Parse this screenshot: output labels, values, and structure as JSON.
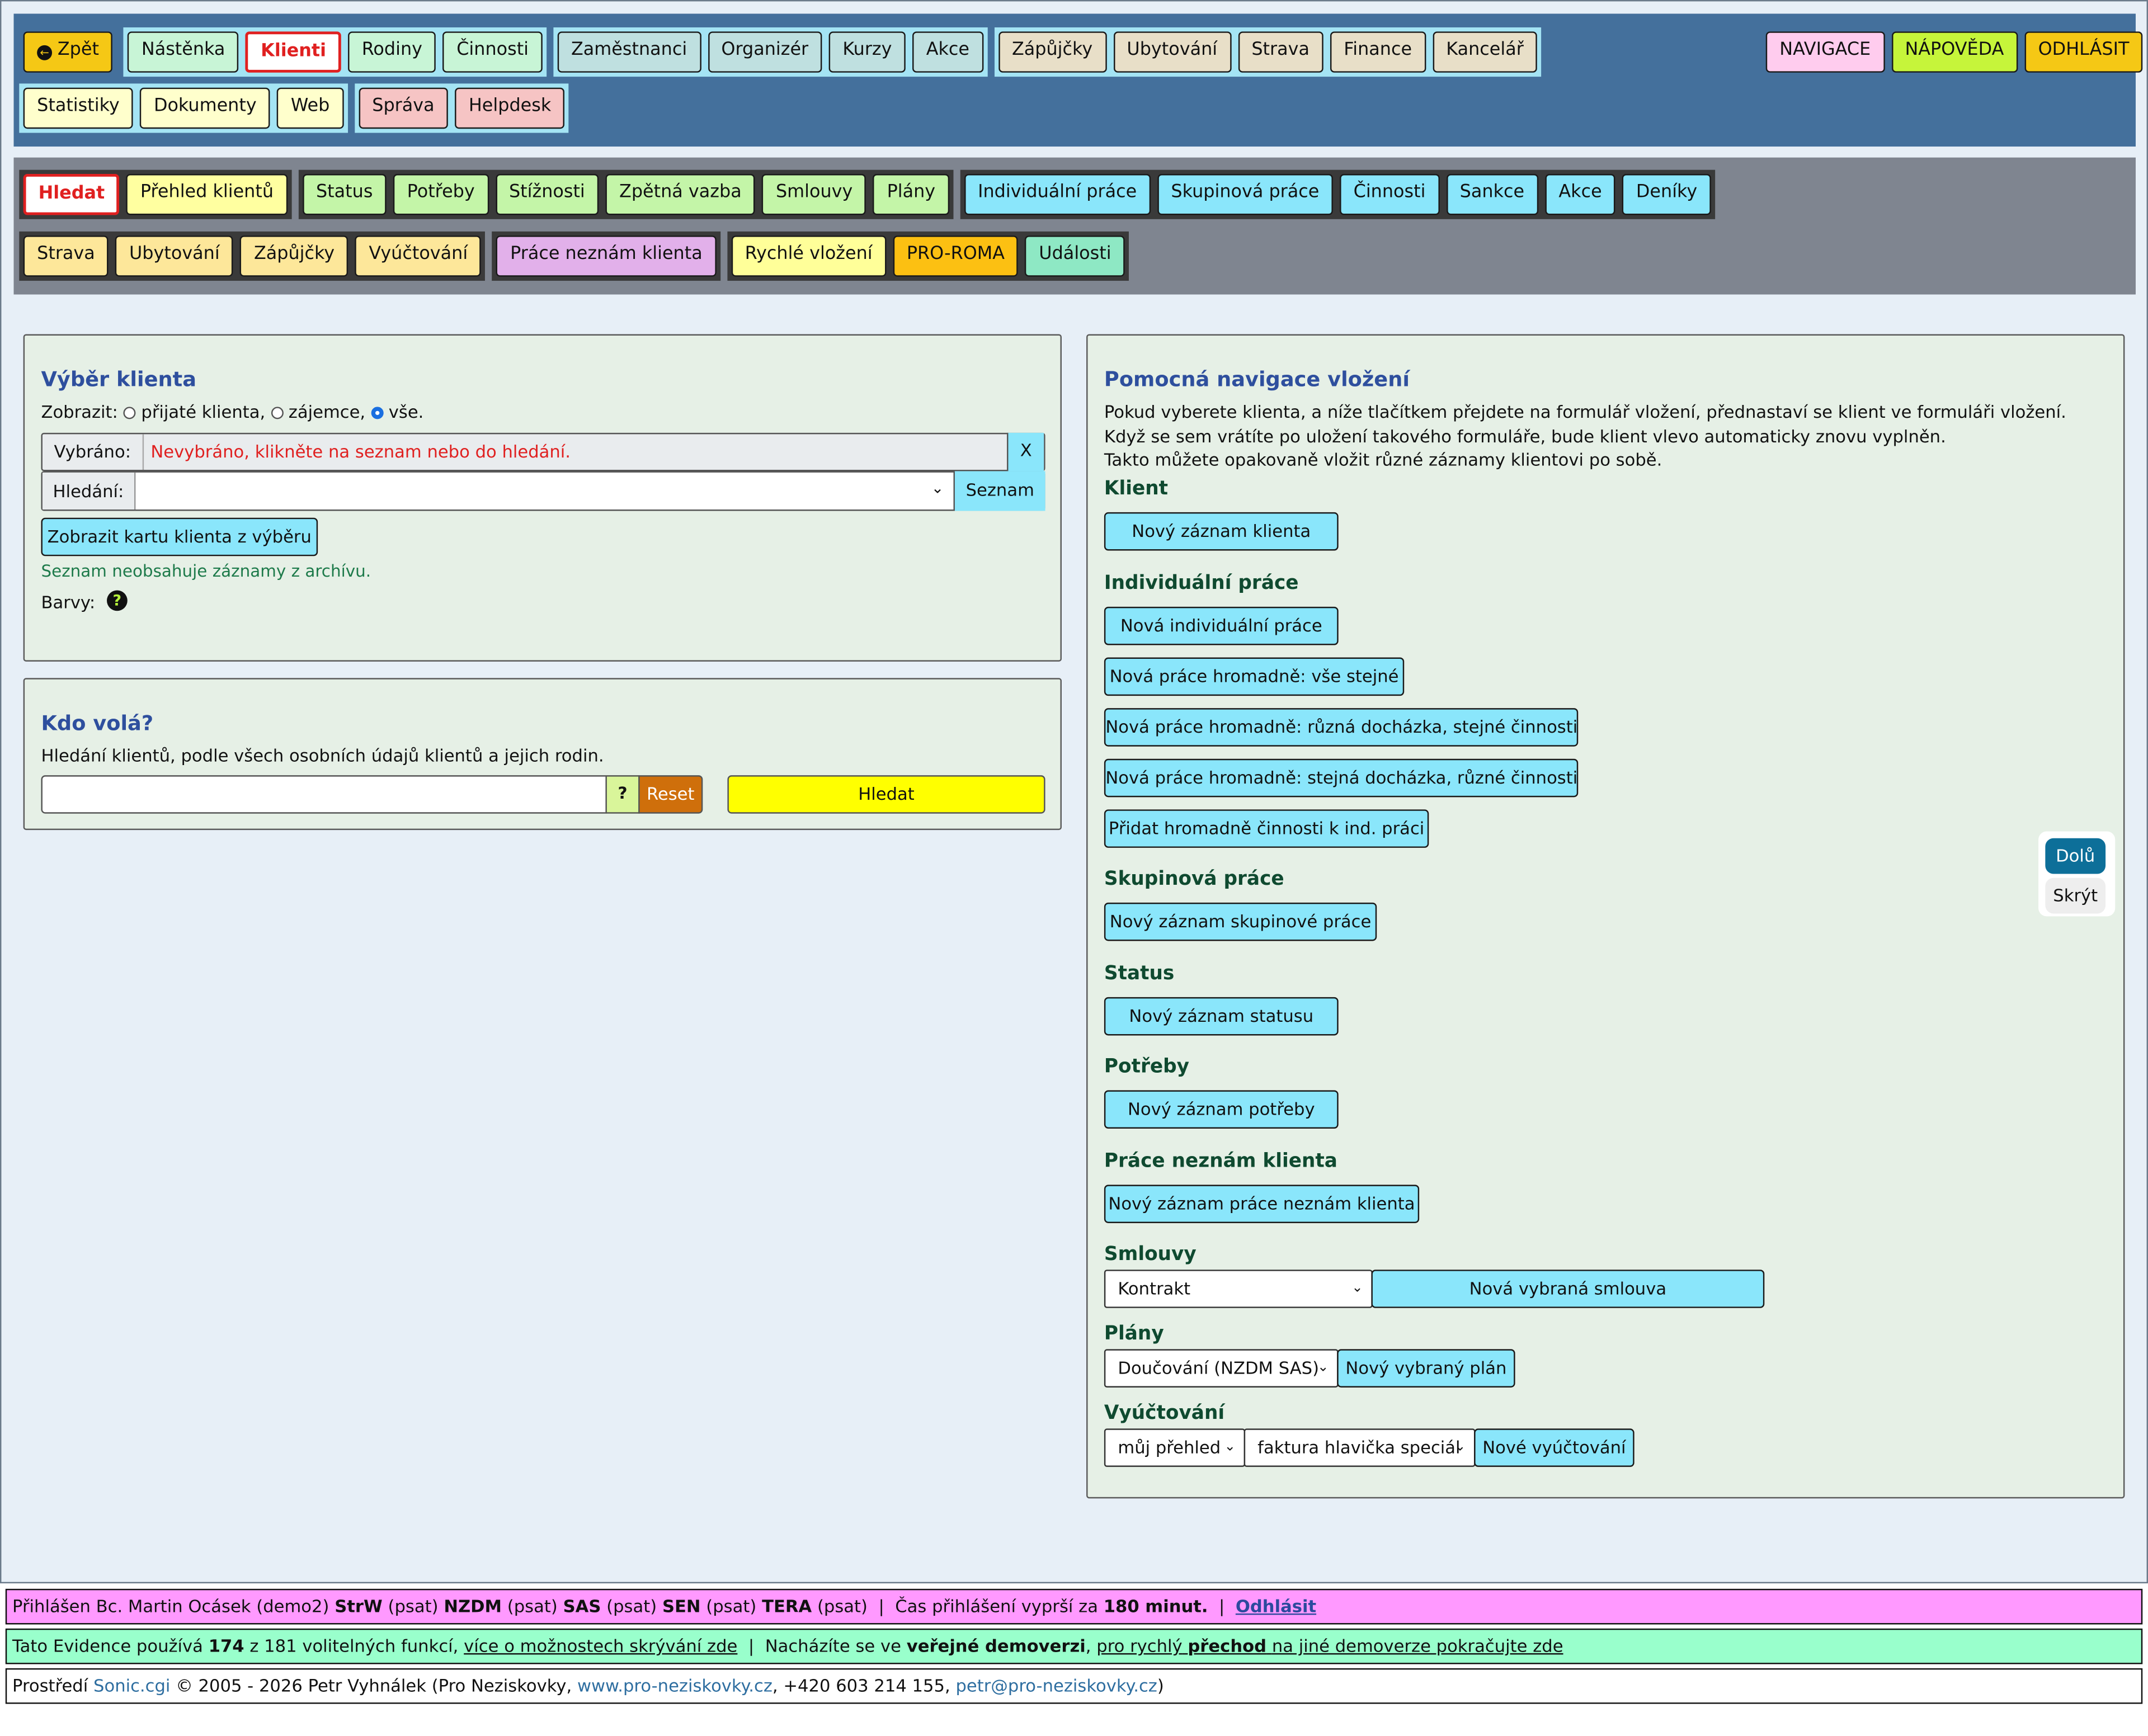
{
  "topnav": {
    "row1": [
      {
        "items": [
          {
            "label": "Zpět",
            "color": "#f5c815",
            "icon": "arrow-left-circle-icon"
          }
        ],
        "bg": "#44709c"
      },
      {
        "items": [
          {
            "label": "Nástěnka",
            "color": "#c8f5d6"
          },
          {
            "label": "Klienti",
            "color": "#ffffff",
            "active": true
          },
          {
            "label": "Rodiny",
            "color": "#c8f5d6"
          },
          {
            "label": "Činnosti",
            "color": "#c8f5d6"
          }
        ],
        "bg": "#a4e4f4"
      },
      {
        "items": [
          {
            "label": "Zaměstnanci",
            "color": "#bfe0e0"
          },
          {
            "label": "Organizér",
            "color": "#bfe0e0"
          },
          {
            "label": "Kurzy",
            "color": "#bfe0e0"
          },
          {
            "label": "Akce",
            "color": "#bfe0e0"
          }
        ],
        "bg": "#a4e4f4"
      },
      {
        "items": [
          {
            "label": "Zápůjčky",
            "color": "#e8dfc8"
          },
          {
            "label": "Ubytování",
            "color": "#e8dfc8"
          },
          {
            "label": "Strava",
            "color": "#e8dfc8"
          },
          {
            "label": "Finance",
            "color": "#e8dfc8"
          },
          {
            "label": "Kancelář",
            "color": "#e8dfc8"
          }
        ],
        "bg": "#a4e4f4"
      }
    ],
    "row2": [
      {
        "items": [
          {
            "label": "Statistiky",
            "color": "#ffffcc"
          },
          {
            "label": "Dokumenty",
            "color": "#ffffcc"
          },
          {
            "label": "Web",
            "color": "#ffffcc"
          }
        ],
        "bg": "#a4e4f4"
      },
      {
        "items": [
          {
            "label": "Správa",
            "color": "#f6c4c4"
          },
          {
            "label": "Helpdesk",
            "color": "#f6c4c4"
          }
        ],
        "bg": "#a4e4f4"
      }
    ],
    "right": [
      {
        "label": "NAVIGACE",
        "color": "#ffccee"
      },
      {
        "label": "NÁPOVĚDA",
        "color": "#c6f53a"
      },
      {
        "label": "ODHLÁSIT",
        "color": "#f5c815"
      }
    ]
  },
  "subnav": {
    "row1": [
      {
        "items": [
          {
            "label": "Hledat",
            "color": "#ffffff",
            "active": true
          },
          {
            "label": "Přehled klientů",
            "color": "#ffffa0"
          }
        ]
      },
      {
        "items": [
          {
            "label": "Status",
            "color": "#c4f5a8"
          },
          {
            "label": "Potřeby",
            "color": "#c4f5a8"
          },
          {
            "label": "Stížnosti",
            "color": "#c4f5a8"
          },
          {
            "label": "Zpětná vazba",
            "color": "#c4f5a8"
          },
          {
            "label": "Smlouvy",
            "color": "#c4f5a8"
          },
          {
            "label": "Plány",
            "color": "#c4f5a8"
          }
        ]
      },
      {
        "items": [
          {
            "label": "Individuální práce",
            "color": "#8ae6fb"
          },
          {
            "label": "Skupinová práce",
            "color": "#8ae6fb"
          },
          {
            "label": "Činnosti",
            "color": "#8ae6fb"
          },
          {
            "label": "Sankce",
            "color": "#8ae6fb"
          },
          {
            "label": "Akce",
            "color": "#8ae6fb"
          },
          {
            "label": "Deníky",
            "color": "#8ae6fb"
          }
        ]
      }
    ],
    "row2": [
      {
        "items": [
          {
            "label": "Strava",
            "color": "#fde79a"
          },
          {
            "label": "Ubytování",
            "color": "#fde79a"
          },
          {
            "label": "Zápůjčky",
            "color": "#fde79a"
          },
          {
            "label": "Vyúčtování",
            "color": "#fde79a"
          }
        ]
      },
      {
        "items": [
          {
            "label": "Práce neznám klienta",
            "color": "#e2b0ea"
          }
        ]
      },
      {
        "items": [
          {
            "label": "Rychlé vložení",
            "color": "#ffff99"
          },
          {
            "label": "PRO-ROMA",
            "color": "#fcc012"
          },
          {
            "label": "Události",
            "color": "#8ee8c4"
          }
        ]
      }
    ]
  },
  "vyber": {
    "title": "Výběr klienta",
    "show_label": "Zobrazit:",
    "opt1": "přijaté klienta,",
    "opt2": "zájemce,",
    "opt3": "vše.",
    "selected_label": "Vybráno:",
    "selected_value": "Nevybráno, klikněte na seznam nebo do hledání.",
    "clear_label": "X",
    "search_label": "Hledání:",
    "list_label": "Seznam",
    "show_card_label": "Zobrazit kartu klienta z výběru",
    "archive_note": "Seznam neobsahuje záznamy z archívu.",
    "colors_label": "Barvy:"
  },
  "kdovola": {
    "title": "Kdo volá?",
    "desc": "Hledání klientů, podle všech osobních údajů klientů a jejich rodin.",
    "help_label": "?",
    "reset_label": "Reset",
    "search_label": "Hledat"
  },
  "pomocna": {
    "title": "Pomocná navigace vložení",
    "line1": "Pokud vyberete klienta, a níže tlačítkem přejdete na formulář vložení, přednastaví se klient ve formuláři vložení.",
    "line2": "Když se sem vrátíte po uložení takového formuláře, bude klient vlevo automaticky znovu vyplněn.",
    "line3": "Takto můžete opakovaně vložit různé záznamy klientovi po sobě.",
    "klient_h": "Klient",
    "klient_btn": "Nový záznam klienta",
    "ind_h": "Individuální práce",
    "ind_b1": "Nová individuální práce",
    "ind_b2": "Nová práce hromadně: vše stejné",
    "ind_b3": "Nová práce hromadně: různá docházka, stejné činnosti",
    "ind_b4": "Nová práce hromadně: stejná docházka, různé činnosti",
    "ind_b5": "Přidat hromadně činnosti k ind. práci",
    "sk_h": "Skupinová práce",
    "sk_btn": "Nový záznam skupinové práce",
    "st_h": "Status",
    "st_btn": "Nový záznam statusu",
    "po_h": "Potřeby",
    "po_btn": "Nový záznam potřeby",
    "pn_h": "Práce neznám klienta",
    "pn_btn": "Nový záznam práce neznám klienta",
    "sm_h": "Smlouvy",
    "sm_sel": "Kontrakt",
    "sm_btn": "Nová vybraná smlouva",
    "pl_h": "Plány",
    "pl_sel": "Doučování (NZDM SAS)",
    "pl_btn": "Nový vybraný plán",
    "vy_h": "Vyúčtování",
    "vy_sel1": "můj přehled",
    "vy_sel2": "faktura hlavička speciál",
    "vy_btn": "Nové vyúčtování"
  },
  "side": {
    "down": "Dolů",
    "hide": "Skrýt"
  },
  "footer": {
    "f1_a": "Přihlášen Bc. Martin Ocásek (demo2)",
    "f1_b1": "StrW",
    "f1_p1": "(psat)",
    "f1_b2": "NZDM",
    "f1_p2": "(psat)",
    "f1_b3": "SAS",
    "f1_p3": "(psat)",
    "f1_b4": "SEN",
    "f1_p4": "(psat)",
    "f1_b5": "TERA",
    "f1_p5": "(psat)",
    "f1_sep": "|",
    "f1_c": "Čas přihlášení vyprší za",
    "f1_d": "180 minut.",
    "f1_link": "Odhlásit",
    "f2_a": "Tato Evidence používá",
    "f2_b": "174",
    "f2_c": "z 181 volitelných funkcí,",
    "f2_link1": "více o možnostech skrývání zde",
    "f2_sep": "|",
    "f2_d": "Nacházíte se ve",
    "f2_e": "veřejné demoverzi",
    "f2_comma": ",",
    "f2_link2a": "pro rychlý",
    "f2_link2b": "přechod",
    "f2_link2c": "na jiné demoverze pokračujte zde",
    "f3_a": "Prostředí",
    "f3_sonic": "Sonic.cgi",
    "f3_b": "© 2005 - 2026 Petr Vyhnálek (Pro Neziskovky,",
    "f3_web": "www.pro-neziskovky.cz",
    "f3_c": ", +420 603 214 155,",
    "f3_mail": "petr@pro-neziskovky.cz",
    "f3_d": ")"
  }
}
